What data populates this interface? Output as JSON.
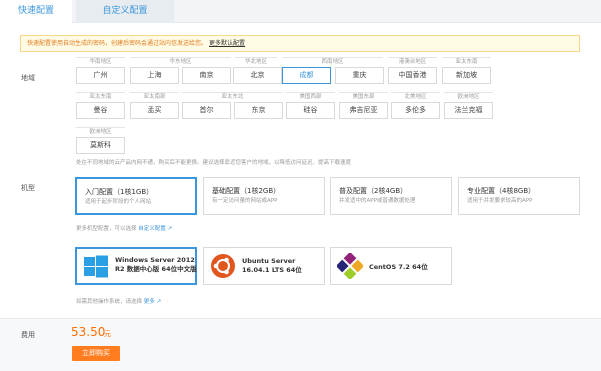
{
  "tabs": [
    {
      "label": "快速配置",
      "active": true
    },
    {
      "label": "自定义配置",
      "active": false
    }
  ],
  "notice": {
    "text": "快速配置使用自动生成的密码，创建后密码会通过站内信发送给您。",
    "link": "更多默认配置"
  },
  "region": {
    "label": "地域",
    "groups_row1": [
      "华南地区",
      "华东地区",
      "华北地区",
      "西南地区",
      "港澳台地区",
      "亚太东南"
    ],
    "row1": [
      "广州",
      "上海",
      "南京",
      "北京",
      "成都",
      "重庆",
      "中国香港",
      "新加坡"
    ],
    "groups_row2": [
      "亚太东南",
      "亚太南部",
      "亚太东北",
      "美国西部",
      "美国东部",
      "北美地区",
      "欧洲地区"
    ],
    "row2": [
      "曼谷",
      "孟买",
      "首尔",
      "东京",
      "硅谷",
      "弗吉尼亚",
      "多伦多",
      "法兰克福"
    ],
    "groups_row3": [
      "欧洲地区"
    ],
    "row3": [
      "莫斯科"
    ],
    "selected": "成都",
    "hint": "处在不同地域的云产品内网不通，购买后不能更换。建议选择靠近您客户的地域，以降低访问延迟、提高下载速度"
  },
  "model": {
    "label": "机型",
    "configs": [
      {
        "title": "入门配置（1核1GB）",
        "desc": "适用于起步阶段的个人网站",
        "selected": true
      },
      {
        "title": "基础配置（1核2GB）",
        "desc": "有一定访问量的网站或APP",
        "selected": false
      },
      {
        "title": "普及配置（2核4GB）",
        "desc": "并发适中的APP或普通数据处理",
        "selected": false
      },
      {
        "title": "专业配置（4核8GB）",
        "desc": "适用于并发要求较高的APP",
        "selected": false
      }
    ],
    "more_hint": "更多机型配置，可以选择",
    "more_link": "自定义配置",
    "os": [
      {
        "name": "Windows Server 2012 R2 数据中心版 64位中文版",
        "icon": "windows-icon",
        "selected": true
      },
      {
        "name": "Ubuntu Server 16.04.1 LTS 64位",
        "icon": "ubuntu-icon",
        "selected": false
      },
      {
        "name": "CentOS 7.2 64位",
        "icon": "centos-icon",
        "selected": false
      }
    ],
    "os_hint": "如需其他操作系统，请选择",
    "os_link": "更多"
  },
  "footer": {
    "price_label": "费用",
    "price": "53.50",
    "unit": "元",
    "buy": "立即购买"
  },
  "colors": {
    "accent": "#3c96db",
    "price": "#ff6d00",
    "buy_button": "#ff7c1f"
  }
}
